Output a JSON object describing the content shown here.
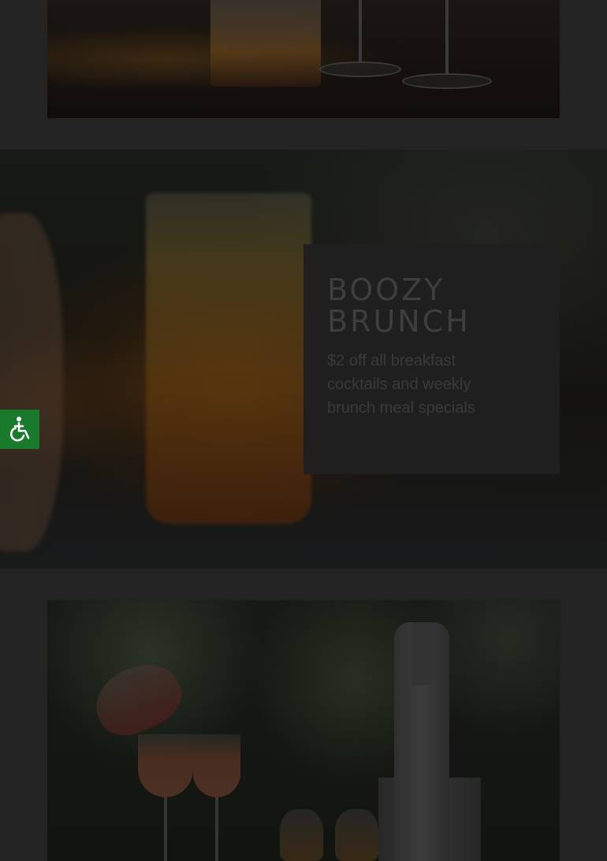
{
  "promo": {
    "title": "BOOZY BRUNCH",
    "description": "$2 off all breakfast cocktails and weekly brunch meal specials"
  },
  "accessibility": {
    "icon": "wheelchair-icon",
    "color": "#1a7a2c"
  },
  "images": {
    "top": "orange-juice-and-wine-glasses-photo",
    "banner": "boozy-brunch-juice-glass-photo",
    "bottom": "wine-carafe-and-champagne-bucket-photo"
  }
}
